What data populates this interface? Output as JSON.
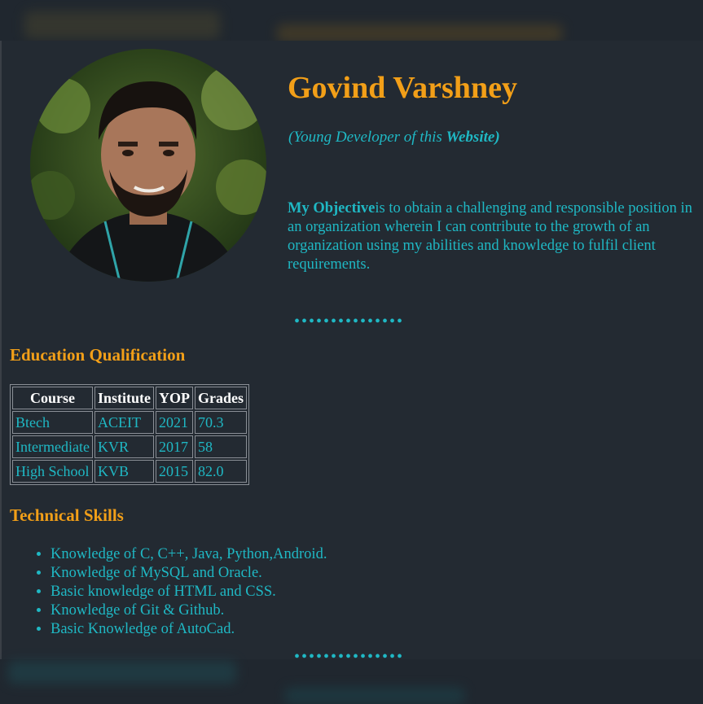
{
  "profile": {
    "name": "Govind Varshney",
    "subtitle_prefix": "(Young Developer of this ",
    "subtitle_bold": "Website)",
    "objective_label": "My Objective",
    "objective_text": "is to obtain a challenging and responsible position in an organization wherein I can contribute to the growth of an organization using my abilities and knowledge to fulfil client requirements."
  },
  "separator": "•••••••••••••••",
  "education": {
    "title": "Education Qualification",
    "headers": [
      "Course",
      "Institute",
      "YOP",
      "Grades"
    ],
    "rows": [
      [
        "Btech",
        "ACEIT",
        "2021",
        "70.3"
      ],
      [
        "Intermediate",
        "KVR",
        "2017",
        "58"
      ],
      [
        "High School",
        "KVB",
        "2015",
        "82.0"
      ]
    ]
  },
  "skills": {
    "title": "Technical Skills",
    "items": [
      "Knowledge of C, C++, Java, Python,Android.",
      "Knowledge of MySQL and Oracle.",
      "Basic knowledge of HTML and CSS.",
      "Knowledge of Git & Github.",
      "Basic Knowledge of AutoCad."
    ]
  },
  "colors": {
    "background": "#20272f",
    "accent_orange": "#f29f18",
    "accent_teal": "#1fb8c4"
  }
}
